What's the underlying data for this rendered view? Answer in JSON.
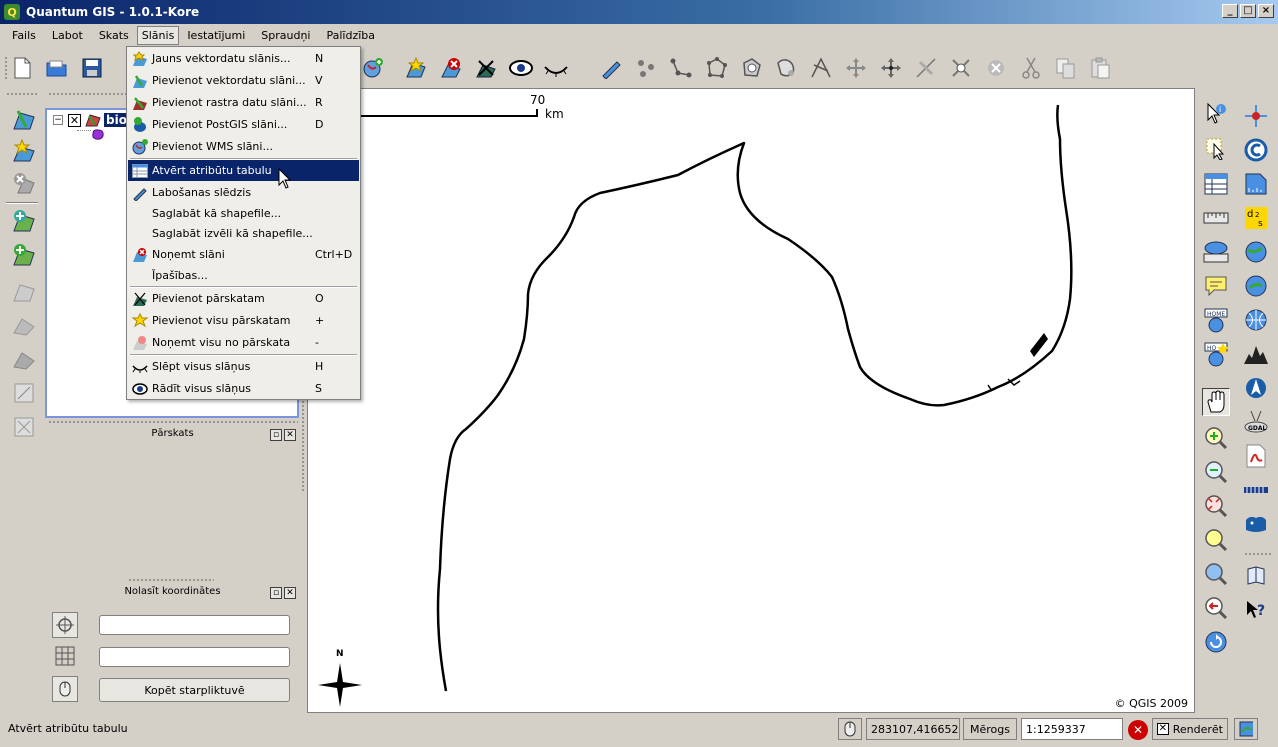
{
  "window": {
    "title": "Quantum GIS - 1.0.1-Kore",
    "app_icon_letter": "Q",
    "controls": [
      "_",
      "□",
      "×"
    ]
  },
  "menubar": [
    "Fails",
    "Labot",
    "Skats",
    "Slānis",
    "Iestatījumi",
    "Spraudņi",
    "Palīdzība"
  ],
  "layer_menu": {
    "items": [
      {
        "label": "Jauns vektordatu slānis...",
        "shortcut": "N",
        "icon": "new-vector-icon"
      },
      {
        "label": "Pievienot vektordatu slāni...",
        "shortcut": "V",
        "icon": "add-vector-icon"
      },
      {
        "label": "Pievienot rastra datu slāni...",
        "shortcut": "R",
        "icon": "add-raster-icon"
      },
      {
        "label": "Pievienot PostGIS slāni...",
        "shortcut": "D",
        "icon": "add-postgis-icon"
      },
      {
        "label": "Pievienot WMS slāni...",
        "shortcut": "",
        "icon": "add-wms-icon"
      },
      {
        "label": "Atvērt atribūtu tabulu",
        "shortcut": "",
        "icon": "attribute-table-icon",
        "highlighted": true
      },
      {
        "label": "Labošanas slēdzis",
        "shortcut": "",
        "icon": "toggle-edit-icon"
      },
      {
        "label": "Saglabāt kā shapefile...",
        "shortcut": "",
        "icon": ""
      },
      {
        "label": "Saglabāt izvēli kā shapefile...",
        "shortcut": "",
        "icon": ""
      },
      {
        "label": "Noņemt slāni",
        "shortcut": "Ctrl+D",
        "icon": "remove-layer-icon"
      },
      {
        "label": "Īpašības...",
        "shortcut": "",
        "icon": ""
      },
      {
        "label": "Pievienot pārskatam",
        "shortcut": "O",
        "icon": "add-overview-icon"
      },
      {
        "label": "Pievienot visu pārskatam",
        "shortcut": "+",
        "icon": "add-all-overview-icon"
      },
      {
        "label": "Noņemt visu no pārskata",
        "shortcut": "-",
        "icon": "remove-all-overview-icon"
      },
      {
        "label": "Slēpt visus slāņus",
        "shortcut": "H",
        "icon": "hide-all-icon"
      },
      {
        "label": "Rādīt visus slāņus",
        "shortcut": "S",
        "icon": "show-all-icon"
      }
    ]
  },
  "legend": {
    "layer_name": "bio",
    "toggle": "−",
    "check": "✕"
  },
  "panels": {
    "overview_title": "Pārskats",
    "coords_title": "Nolasīt koordinātes",
    "copy_button": "Kopēt starpliktuvē",
    "coord_value_1": "",
    "coord_value_2": ""
  },
  "map": {
    "scalebar_value": "70",
    "scalebar_unit": "km",
    "north_label": "N",
    "copyright": "© QGIS 2009"
  },
  "status": {
    "message": "Atvērt atribūtu tabulu",
    "coordinates": "283107,416652",
    "scale_label": "Mērogs",
    "scale_value": "1:1259337",
    "render_label": "Renderēt",
    "render_checked": "✕",
    "stop_icon": "✕"
  },
  "colors": {
    "title_start": "#0a246a",
    "title_end": "#a6caf0",
    "highlight": "#0a246a",
    "map_line": "#000000"
  }
}
